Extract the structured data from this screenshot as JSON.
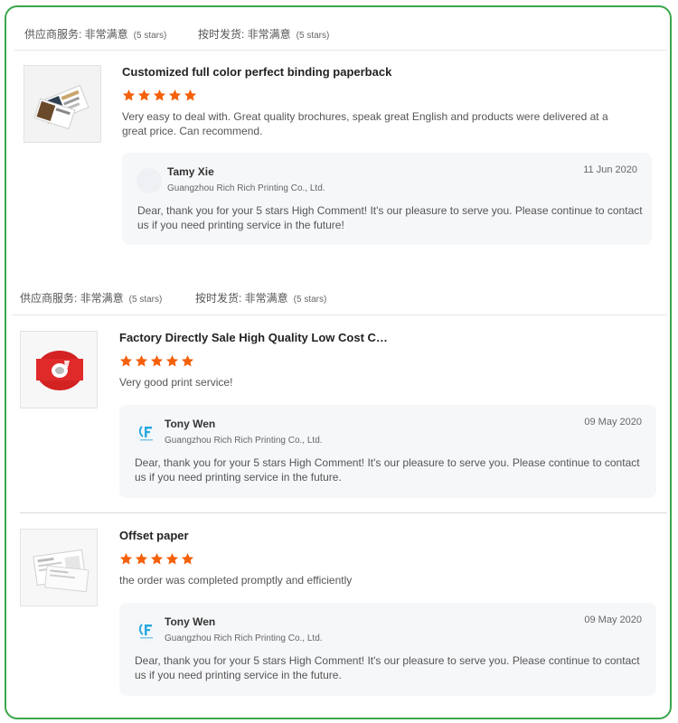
{
  "colors": {
    "frame_border": "#3aa64c",
    "star": "#f5600a"
  },
  "ratings_bars": [
    {
      "supplier_label": "供应商服务: 非常满意",
      "supplier_count": "(5 stars)",
      "shipping_label": "按时发货: 非常满意",
      "shipping_count": "(5 stars)"
    },
    {
      "supplier_label": "供应商服务: 非常满意",
      "supplier_count": "(5 stars)",
      "shipping_label": "按时发货: 非常满意",
      "shipping_count": "(5 stars)"
    }
  ],
  "reviews": [
    {
      "product_title": "Customized full color perfect binding paperback",
      "rating": 5,
      "review_text": "Very easy to deal with. Great quality brochures, speak great English and products were delivered at a great price. Can recommend.",
      "reply": {
        "name": "Tamy Xie",
        "company": "Guangzhou Rich Rich Printing Co., Ltd.",
        "date": "11 Jun 2020",
        "text": "Dear, thank you for your 5 stars High Comment! It's our pleasure to serve you. Please continue to contact us if you need printing service in the future!"
      }
    },
    {
      "product_title": "Factory Directly Sale High Quality Low Cost Cu...",
      "rating": 5,
      "review_text": "Very good print service!",
      "reply": {
        "name": "Tony Wen",
        "company": "Guangzhou Rich Rich Printing Co., Ltd.",
        "date": "09 May 2020",
        "text": "Dear, thank you for your 5 stars High Comment! It's our pleasure to serve you. Please continue to contact us if you need printing service in the future."
      }
    },
    {
      "product_title": "Offset paper",
      "rating": 5,
      "review_text": "the order was completed promptly and efficiently",
      "reply": {
        "name": "Tony Wen",
        "company": "Guangzhou Rich Rich Printing Co., Ltd.",
        "date": "09 May 2020",
        "text": "Dear, thank you for your 5 stars High Comment! It's our pleasure to serve you. Please continue to contact us if you need printing service in the future."
      }
    }
  ]
}
